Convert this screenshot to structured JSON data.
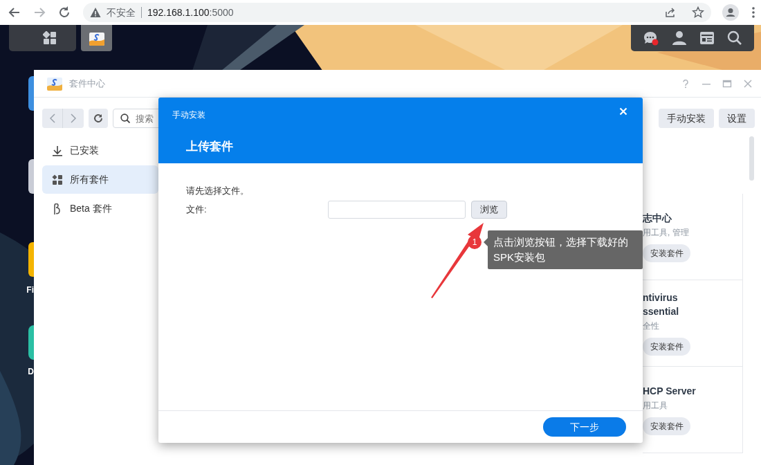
{
  "browser": {
    "nav_buttons": [
      {
        "kind": "back",
        "disabled": false
      },
      {
        "kind": "forward",
        "disabled": true
      },
      {
        "kind": "reload",
        "disabled": false
      }
    ],
    "security_label": "不安全",
    "url_host": "192.168.1.100",
    "url_port": ":5000"
  },
  "taskbar": {
    "chat_unread": true
  },
  "desktop_icons": [
    {
      "color": "#3d8fe0"
    },
    {
      "color": "#c9ccd6"
    },
    {
      "color": "#f4b400",
      "label": "Fi"
    },
    {
      "color": "#2bbfa4",
      "label": "D"
    }
  ],
  "window": {
    "title": "套件中心",
    "search": {
      "placeholder": "搜索"
    },
    "toolbar_buttons": [
      "手动安装",
      "设置"
    ],
    "sidebar": [
      {
        "kind": "installed",
        "label": "已安装",
        "selected": false
      },
      {
        "kind": "all",
        "label": "所有套件",
        "selected": true
      },
      {
        "kind": "beta",
        "label": "Beta 套件",
        "selected": false
      }
    ],
    "cards": [
      {
        "title_lines": [
          "志中心"
        ],
        "subtitle": "用工具, 管理",
        "button": "安装套件"
      },
      {
        "title_lines": [
          "ntivirus",
          "ssential"
        ],
        "subtitle": "全性",
        "button": "安装套件"
      },
      {
        "title_lines": [
          "HCP Server"
        ],
        "subtitle": "用工具",
        "button": "安装套件"
      }
    ]
  },
  "dialog": {
    "header": "手动安装",
    "title": "上传套件",
    "prompt": "请先选择文件。",
    "file_label": "文件:",
    "browse_button": "浏览",
    "next_button": "下一步"
  },
  "annotation": {
    "number": "1",
    "text": "点击浏览按钮，选择下载好的SPK安装包"
  }
}
